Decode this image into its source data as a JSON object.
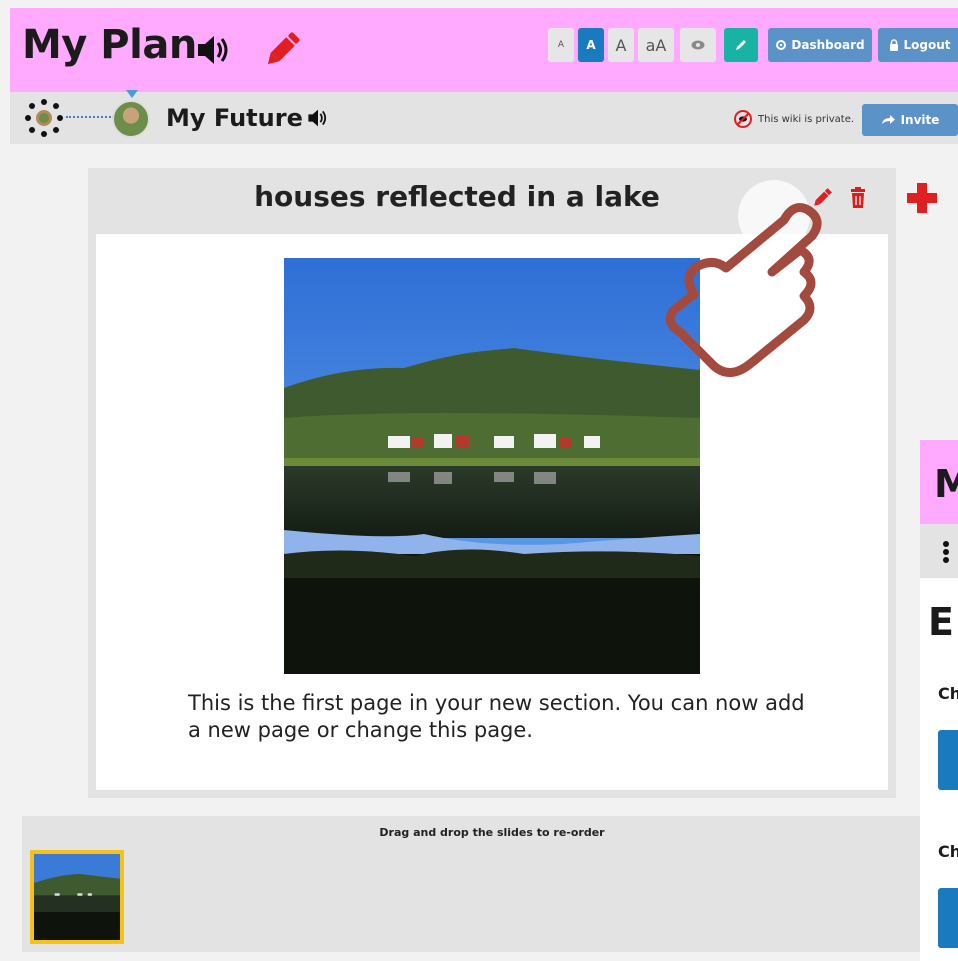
{
  "header": {
    "title": "My Plan",
    "font_buttons": [
      "A",
      "A",
      "A",
      "aA"
    ],
    "dashboard_label": "Dashboard",
    "logout_label": "Logout"
  },
  "subheader": {
    "title": "My Future",
    "privacy_text": "This wiki is private.",
    "invite_label": "Invite"
  },
  "page": {
    "title": "houses reflected in a lake",
    "caption": "This is the first page in your new section. You can now add a new page or change this page."
  },
  "slides": {
    "instructions": "Drag and drop the slides to re-order"
  },
  "side_window": {
    "header_letter": "M",
    "title_letter": "E",
    "label_1": "Ch",
    "label_2": "Ch"
  },
  "colors": {
    "header_pink": "#ffaaff",
    "accent_blue": "#1a7abf",
    "button_blue": "#5b93c9",
    "teal": "#18b3a3",
    "danger_red": "#e02020",
    "highlight_yellow": "#f5c21b"
  }
}
